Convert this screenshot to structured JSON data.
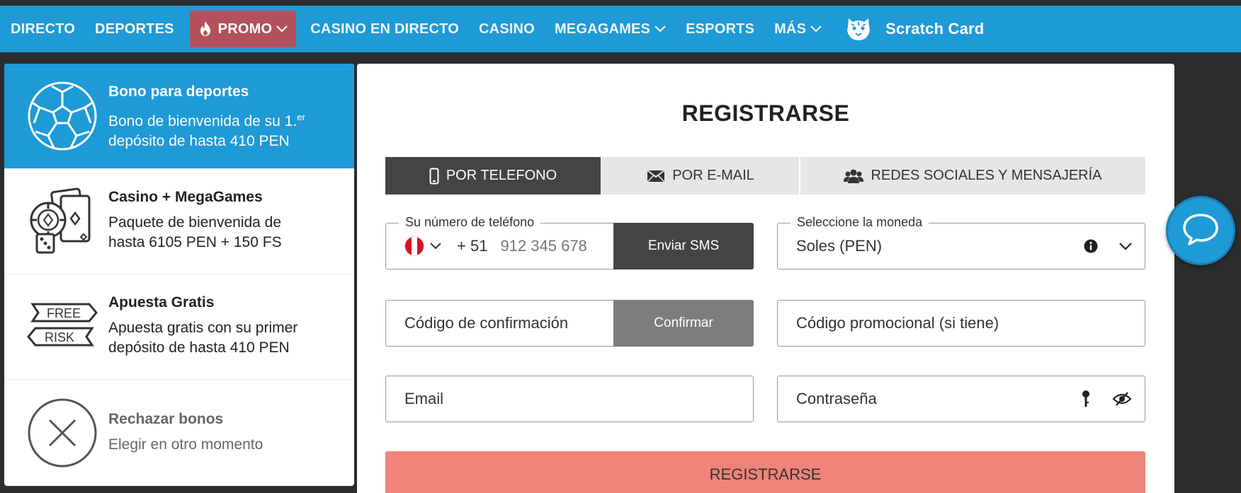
{
  "nav": {
    "items": [
      {
        "label": "DIRECTO"
      },
      {
        "label": "DEPORTES"
      },
      {
        "label": "PROMO"
      },
      {
        "label": "CASINO EN DIRECTO"
      },
      {
        "label": "CASINO"
      },
      {
        "label": "MEGAGAMES"
      },
      {
        "label": "ESPORTS"
      },
      {
        "label": "MÁS"
      }
    ],
    "scratch_label": "Scratch Card"
  },
  "bonuses": [
    {
      "title": "Bono para deportes",
      "desc_line1": "Bono de bienvenida de su 1.",
      "desc_sup": "er",
      "desc_line2": "depósito de hasta 410 PEN",
      "icon": "soccer-ball-icon"
    },
    {
      "title": "Casino + MegaGames",
      "desc_line1": "Paquete de bienvenida de",
      "desc_line2": "hasta 6105 PEN + 150 FS",
      "icon": "casino-chips-cards-icon"
    },
    {
      "title": "Apuesta Gratis",
      "desc_line1": "Apuesta gratis con su primer",
      "desc_line2": "depósito de hasta 410 PEN",
      "icon": "free-risk-icon",
      "icon_text_1": "FREE",
      "icon_text_2": "RISK"
    },
    {
      "title": "Rechazar bonos",
      "desc_line1": "Elegir en otro momento",
      "icon": "reject-x-icon"
    }
  ],
  "register": {
    "title": "REGISTRARSE",
    "tabs": [
      {
        "label": "POR TELEFONO",
        "icon": "phone-icon"
      },
      {
        "label": "POR E-MAIL",
        "icon": "envelope-icon"
      },
      {
        "label": "REDES SOCIALES Y MENSAJERÍA",
        "icon": "users-icon"
      }
    ],
    "phone": {
      "legend": "Su número de teléfono",
      "code": "+ 51",
      "placeholder": "912 345 678",
      "button": "Enviar SMS"
    },
    "currency": {
      "legend": "Seleccione la moneda",
      "value": "Soles (PEN)"
    },
    "confirmation": {
      "placeholder": "Código de confirmación",
      "button": "Confirmar"
    },
    "promo_placeholder": "Código promocional (si tiene)",
    "email_placeholder": "Email",
    "password_placeholder": "Contraseña",
    "submit": "REGISTRARSE"
  },
  "colors": {
    "brand_blue": "#1e9ad6",
    "promo_red": "#b2505d",
    "submit_salmon": "#f0837a"
  }
}
